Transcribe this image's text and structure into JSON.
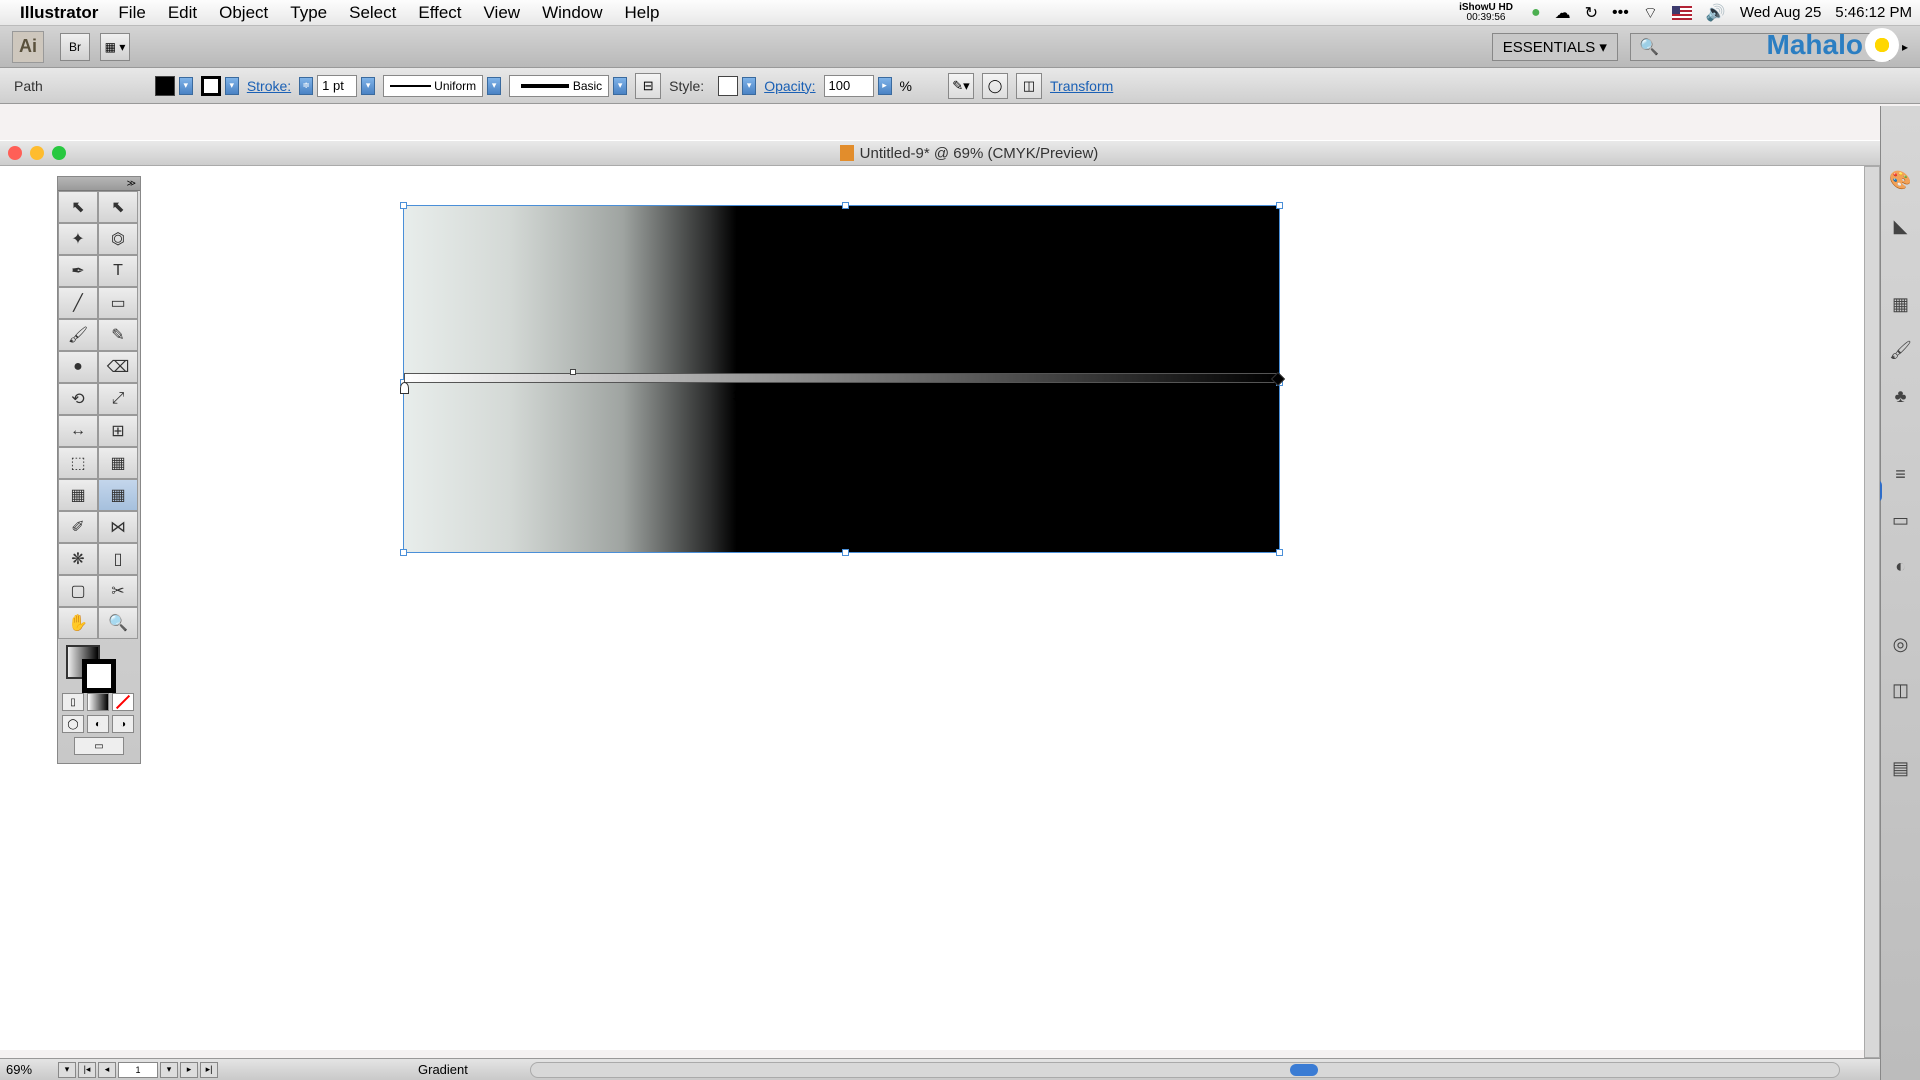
{
  "menubar": {
    "apple": "",
    "app": "Illustrator",
    "items": [
      "File",
      "Edit",
      "Object",
      "Type",
      "Select",
      "Effect",
      "View",
      "Window",
      "Help"
    ],
    "ishowu_top": "iShowU HD",
    "ishowu_bottom": "00:39:56",
    "date": "Wed Aug 25",
    "time": "5:46:12 PM"
  },
  "appbar": {
    "ai": "Ai",
    "br": "Br",
    "workspace": "ESSENTIALS ▾",
    "search_placeholder": "",
    "logo": "Mahalo"
  },
  "ctrl": {
    "selection": "Path",
    "stroke": "Stroke:",
    "stroke_val": "1 pt",
    "profile": "Uniform",
    "brush": "Basic",
    "style": "Style:",
    "opacity": "Opacity:",
    "opacity_val": "100",
    "opacity_unit": "%",
    "transform": "Transform"
  },
  "document": {
    "title": "Untitled-9* @ 69% (CMYK/Preview)"
  },
  "status": {
    "zoom": "69%",
    "artboard": "1",
    "tool": "Gradient"
  },
  "tools": {
    "names": [
      [
        "selection-tool",
        "direct-selection-tool"
      ],
      [
        "magic-wand-tool",
        "lasso-tool"
      ],
      [
        "pen-tool",
        "type-tool"
      ],
      [
        "line-tool",
        "rectangle-tool"
      ],
      [
        "paintbrush-tool",
        "pencil-tool"
      ],
      [
        "blob-brush-tool",
        "eraser-tool"
      ],
      [
        "rotate-tool",
        "scale-tool"
      ],
      [
        "width-tool",
        "free-transform-tool"
      ],
      [
        "shape-builder-tool",
        "perspective-tool"
      ],
      [
        "mesh-tool",
        "gradient-tool"
      ],
      [
        "eyedropper-tool",
        "blend-tool"
      ],
      [
        "symbol-sprayer-tool",
        "graph-tool"
      ],
      [
        "artboard-tool",
        "slice-tool"
      ],
      [
        "hand-tool",
        "zoom-tool"
      ]
    ],
    "glyphs": [
      [
        "⬉",
        "⬉"
      ],
      [
        "✦",
        "⏣"
      ],
      [
        "✒",
        "T"
      ],
      [
        "╱",
        "▭"
      ],
      [
        "🖌",
        "✎"
      ],
      [
        "●",
        "⌫"
      ],
      [
        "⟲",
        "⤢"
      ],
      [
        "↔",
        "⊞"
      ],
      [
        "⬚",
        "▦"
      ],
      [
        "▦",
        "▦"
      ],
      [
        "✐",
        "⋈"
      ],
      [
        "❋",
        "▯"
      ],
      [
        "▢",
        "✂"
      ],
      [
        "✋",
        "🔍"
      ]
    ]
  },
  "right_panel": {
    "icons": [
      "color-panel",
      "color-guide-panel",
      "swatches-panel",
      "brushes-panel",
      "symbols-panel",
      "stroke-panel",
      "gradient-panel",
      "transparency-panel",
      "appearance-panel",
      "graphic-styles-panel",
      "layers-panel"
    ],
    "glyphs": [
      "🎨",
      "◣",
      "▦",
      "🖌",
      "♣",
      "≡",
      "▭",
      "◐",
      "◎",
      "◫",
      "▤"
    ]
  }
}
